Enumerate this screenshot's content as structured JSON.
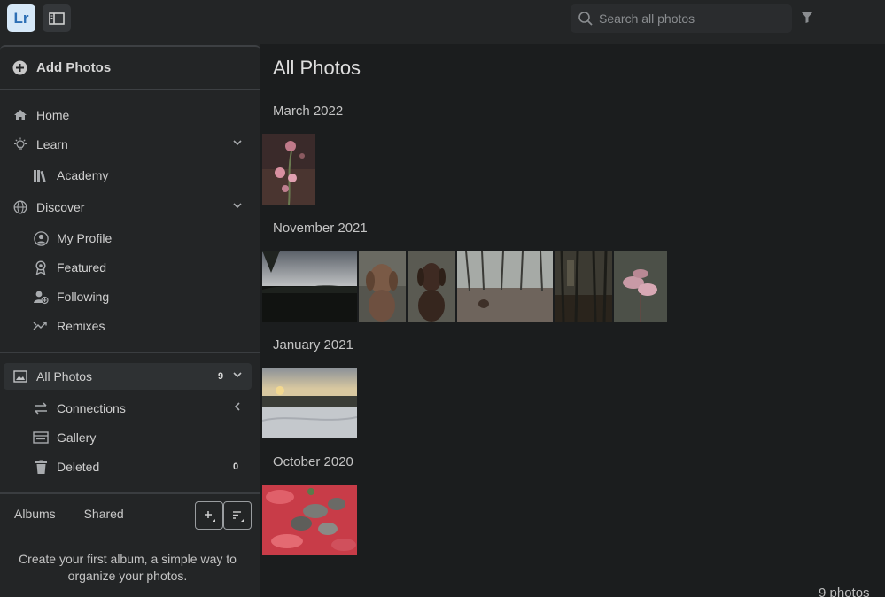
{
  "app": {
    "logo_text": "Lr"
  },
  "search": {
    "placeholder": "Search all photos"
  },
  "sidebar": {
    "add_photos": "Add Photos",
    "nav": {
      "home": "Home",
      "learn": "Learn",
      "academy": "Academy",
      "discover": "Discover",
      "my_profile": "My Profile",
      "featured": "Featured",
      "following": "Following",
      "remixes": "Remixes"
    },
    "library": {
      "all_photos": "All Photos",
      "all_photos_count": "9",
      "connections": "Connections",
      "gallery": "Gallery",
      "deleted": "Deleted",
      "deleted_count": "0"
    },
    "albums": {
      "tab_albums": "Albums",
      "tab_shared": "Shared",
      "empty_line1": "Create your first album, a simple way to",
      "empty_line2": "organize your photos."
    }
  },
  "main": {
    "title": "All Photos",
    "sections": [
      {
        "label": "March 2022"
      },
      {
        "label": "November 2021"
      },
      {
        "label": "January 2021"
      },
      {
        "label": "October 2020"
      }
    ],
    "footer": "9 photos"
  },
  "colors": {
    "background": "#1b1d1e",
    "panel": "#232526",
    "accent_logo_bg": "#d6e8f8",
    "accent_logo_text": "#2d6fb5"
  }
}
